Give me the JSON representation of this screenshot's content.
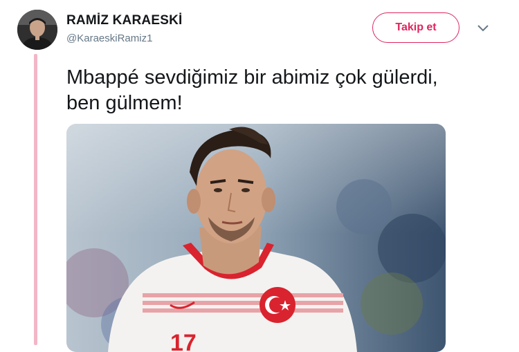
{
  "tweet": {
    "display_name": "RAMİZ KARAESKİ",
    "handle": "@KaraeskiRamiz1",
    "text": "Mbappé sevdiğimiz bir abimiz çok gülerdi, ben gülmem!",
    "follow_label": "Takip et",
    "jersey_number": "17"
  },
  "colors": {
    "accent": "#e0245e",
    "thread_line": "#f3b6c6",
    "handle_gray": "#657786",
    "jersey_red": "#d9232e"
  },
  "icons": {
    "menu": "chevron-down-icon"
  }
}
